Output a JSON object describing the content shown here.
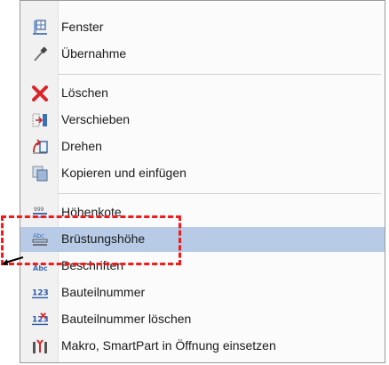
{
  "menu": {
    "items": [
      {
        "label": "Fenster",
        "icon": "window-icon"
      },
      {
        "label": "Übernahme",
        "icon": "eyedropper-icon"
      },
      {
        "label": "Löschen",
        "icon": "delete-x-icon"
      },
      {
        "label": "Verschieben",
        "icon": "move-icon"
      },
      {
        "label": "Drehen",
        "icon": "rotate-icon"
      },
      {
        "label": "Kopieren und einfügen",
        "icon": "copy-paste-icon"
      },
      {
        "label": "Höhenkote",
        "icon": "height-dimension-icon"
      },
      {
        "label": "Brüstungshöhe",
        "icon": "sill-height-icon"
      },
      {
        "label": "Beschriften",
        "icon": "label-text-icon"
      },
      {
        "label": "Bauteilnummer",
        "icon": "component-number-icon"
      },
      {
        "label": "Bauteilnummer löschen",
        "icon": "delete-component-number-icon"
      },
      {
        "label": "Makro, SmartPart in Öffnung einsetzen",
        "icon": "macro-smartpart-icon"
      }
    ],
    "highlighted_item": "Brüstungshöhe",
    "icon_text": {
      "abc": "Abc",
      "num": "123"
    }
  },
  "colors": {
    "highlight": "#b8cbe6",
    "callout": "#ee1c1c",
    "delete_red": "#d9262a"
  }
}
